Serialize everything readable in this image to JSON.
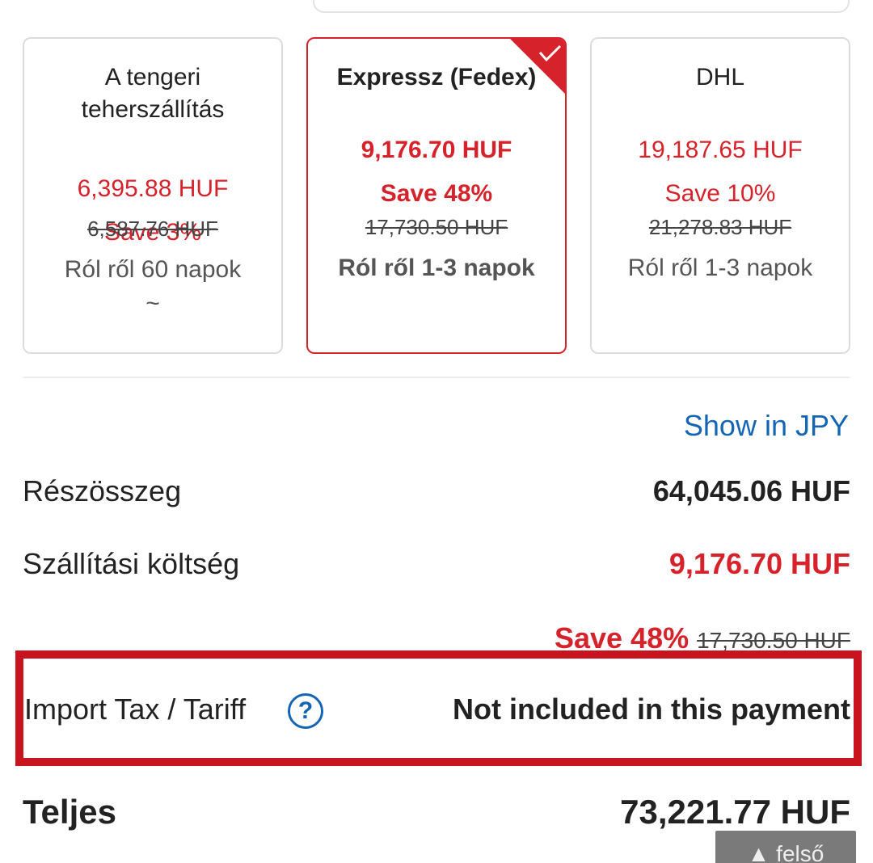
{
  "shipping_options": [
    {
      "name": "A tengeri teherszállítás",
      "price": "6,395.88 HUF",
      "save": "Save 3%",
      "original_price": "6,587.76 HUF",
      "delivery": "Ról ről 60  napok",
      "delivery_extra": "~",
      "selected": false
    },
    {
      "name": "Expressz (Fedex)",
      "price": "9,176.70 HUF",
      "save": "Save 48%",
      "original_price": "17,730.50 HUF",
      "delivery": "Ról ről 1-3  napok",
      "selected": true
    },
    {
      "name": "DHL",
      "price": "19,187.65 HUF",
      "save": "Save 10%",
      "original_price": "21,278.83 HUF",
      "delivery": "Ról ről 1-3  napok",
      "selected": false
    }
  ],
  "show_currency_link": "Show in JPY",
  "summary": {
    "subtotal_label": "Részösszeg",
    "subtotal_value": "64,045.06 HUF",
    "shipping_label": "Szállítási költség",
    "shipping_value": "9,176.70 HUF",
    "shipping_save": "Save 48%",
    "shipping_original": "17,730.50 HUF",
    "tax_label": "Import Tax / Tariff",
    "tax_help": "?",
    "tax_value": "Not included in this payment",
    "total_label": "Teljes",
    "total_value": "73,221.77 HUF"
  },
  "back_to_top_label": "▲ felső",
  "colors": {
    "accent_red": "#d6232b",
    "link_blue": "#1565b5",
    "highlight_border": "#c8141e"
  }
}
